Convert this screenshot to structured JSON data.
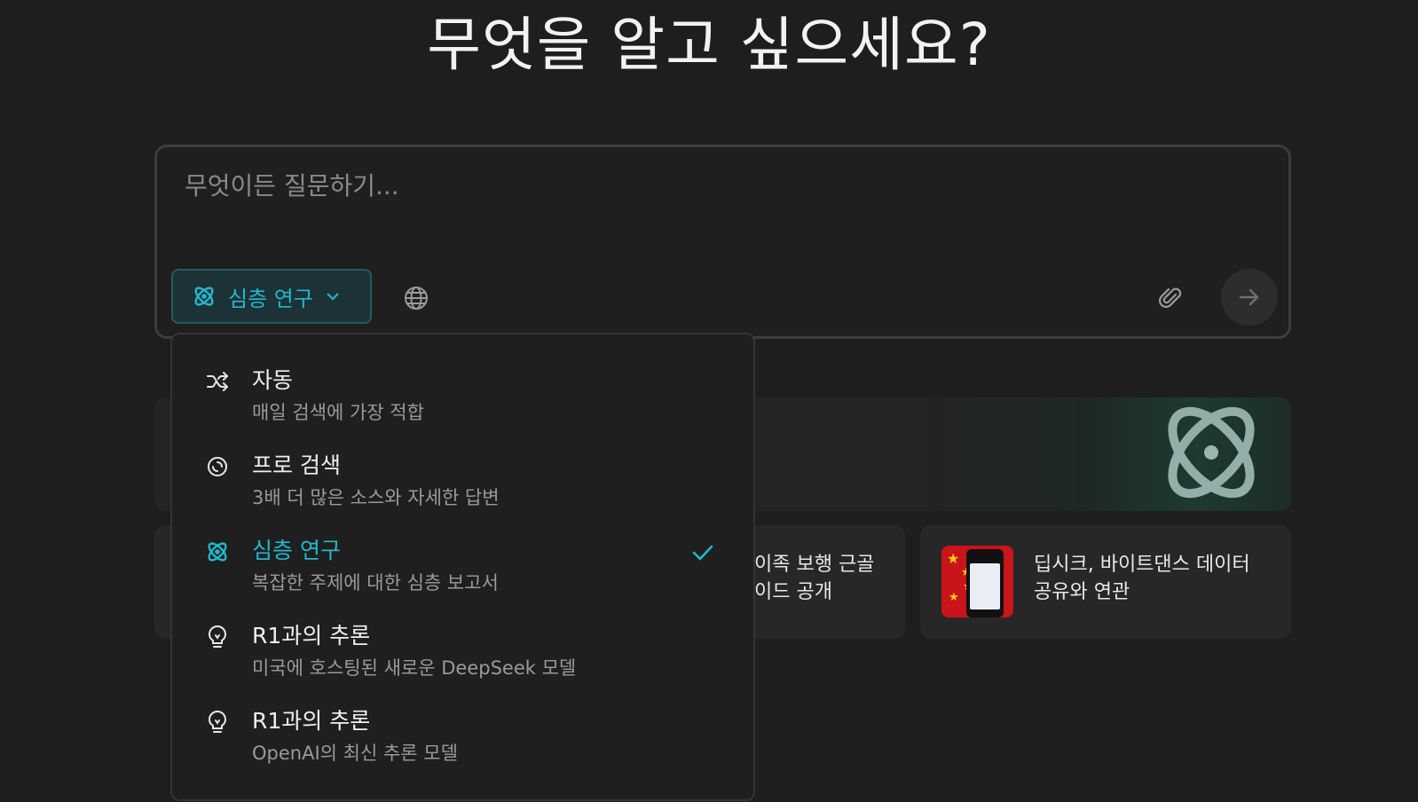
{
  "headline": "무엇을 알고 싶으세요?",
  "search": {
    "placeholder": "무엇이든 질문하기...",
    "value": "",
    "mode_label": "심층 연구",
    "accent_color": "#20b8cd"
  },
  "icons": {
    "mode": "atom-icon",
    "mode_chevron": "chevron-down-icon",
    "globe": "globe-icon",
    "attach": "paperclip-icon",
    "submit": "arrow-right-icon"
  },
  "dropdown": {
    "items": [
      {
        "title": "자동",
        "description": "매일 검색에 가장 적합",
        "icon": "shuffle-icon",
        "selected": false
      },
      {
        "title": "프로 검색",
        "description": "3배 더 많은 소스와 자세한 답변",
        "icon": "swirl-icon",
        "selected": false
      },
      {
        "title": "심층 연구",
        "description": "복잡한 주제에 대한 심층 보고서",
        "icon": "atom-icon",
        "selected": true
      },
      {
        "title": "R1과의 추론",
        "description": "미국에 호스팅된 새로운 DeepSeek 모델",
        "icon": "lightbulb-icon",
        "selected": false
      },
      {
        "title": "R1과의 추론",
        "description": "OpenAI의 최신 추론 모델",
        "icon": "lightbulb-icon",
        "selected": false
      }
    ]
  },
  "cards": {
    "news_mid": {
      "line1": "이족 보행 근골",
      "line2": "이드 공개"
    },
    "news_right": {
      "line1": "딥시크, 바이트댄스 데이터",
      "line2": "공유와 연관"
    }
  }
}
